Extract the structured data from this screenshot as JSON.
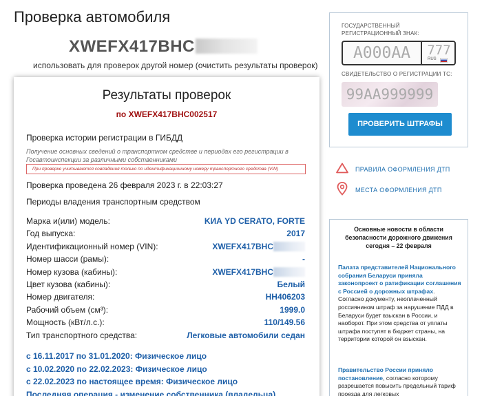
{
  "page": {
    "title": "Проверка автомобиля",
    "vin_visible": "XWEFX417BHC",
    "other_number_link": "использовать для проверок другой номер (очистить результаты проверок)"
  },
  "results": {
    "title": "Результаты проверок",
    "subtitle": "по XWEFX417BHC002517",
    "section_title": "Проверка истории регистрации в ГИБДД",
    "section_desc": "Получение основных сведений о транспортном средстве и периодах его регистрации в Госавтоинспекции за различными собственниками",
    "warning": "При проверке учитываются совпадения только по идентификационному номеру транспортного средства (VIN)",
    "check_date": "Проверка проведена 26 февраля 2023 г. в 22:03:27",
    "periods_title": "Периоды владения транспортным средством",
    "rows": [
      {
        "label": "Марка и(или) модель:",
        "value": "KИА YD CERATO, FORTE"
      },
      {
        "label": "Год выпуска:",
        "value": "2017"
      },
      {
        "label": "Идентификационный номер (VIN):",
        "value": "XWEFX417BHC"
      },
      {
        "label": "Номер шасси (рамы):",
        "value": "-"
      },
      {
        "label": "Номер кузова (кабины):",
        "value": "XWEFX417BHC"
      },
      {
        "label": "Цвет кузова (кабины):",
        "value": "Белый"
      },
      {
        "label": "Номер двигателя:",
        "value": "HH406203"
      },
      {
        "label": "Рабочий объем (см³):",
        "value": "1999.0"
      },
      {
        "label": "Мощность (кВт/л.с.):",
        "value": "110/149.56"
      },
      {
        "label": "Тип транспортного средства:",
        "value": "Легковые автомобили седан"
      }
    ],
    "owners": [
      "с 16.11.2017 по 31.01.2020: Физическое лицо",
      "с 10.02.2020 по 22.02.2023: Физическое лицо",
      "с 22.02.2023 по настоящее время: Физическое лицо"
    ],
    "last_operation": "Последняя операция - изменение собственника (владельца)"
  },
  "plate_widget": {
    "label_line1": "ГОСУДАРСТВЕННЫЙ",
    "label_line2": "РЕГИСТРАЦИОННЫЙ ЗНАК:",
    "plate_number": "А000АА",
    "region_code": "777",
    "region_rus": "RUS",
    "cert_label": "СВИДЕТЕЛЬСТВО О РЕГИСТРАЦИИ ТС:",
    "cert_number": "99АА999999",
    "button": "ПРОВЕРИТЬ ШТРАФЫ",
    "flag_colors": [
      "#ffffff",
      "#2a52be",
      "#d52b1e"
    ]
  },
  "links": {
    "rules": "ПРАВИЛА ОФОРМЛЕНИЯ ДТП",
    "places": "МЕСТА ОФОРМЛЕНИЯ ДТП",
    "accent_color": "#e05a5a"
  },
  "news": {
    "heading": "Основные новости в области безопасности дорожного движения сегодня – 22 февраля",
    "item1_link": "Палата представителей Национального собрания Беларуси приняла законопроект о ратификации соглашения с Россией о дорожных штрафах",
    "item1_text": ". Согласно документу, неоплаченный россиянином штраф за нарушение ПДД в Беларуси будет взыскан в России, и наоборот. При этом средства от уплаты штрафа поступят в бюджет страны, на территории которой он взыскан.",
    "item2_link": "Правительство России приняло постановление",
    "item2_text": ", согласно которому разрешается повысить предельный тариф проезда для легковых"
  }
}
